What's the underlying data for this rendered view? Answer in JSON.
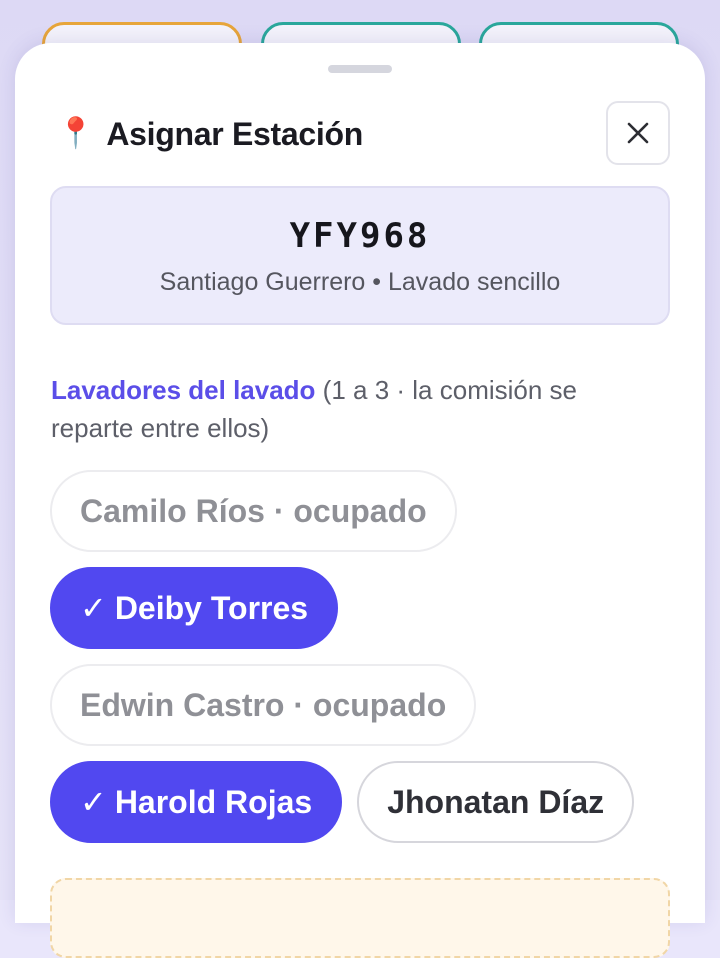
{
  "sheet": {
    "title": "Asignar Estación",
    "title_icon": "📍",
    "close_icon": "close-icon"
  },
  "vehicle": {
    "plate": "YFY968",
    "subtitle": "Santiago Guerrero • Lavado sencillo"
  },
  "washers_section": {
    "label": "Lavadores del lavado",
    "hint": " (1 a 3 · la comisión se reparte entre ellos)"
  },
  "washers": [
    {
      "name": "Camilo Ríos · ocupado",
      "state": "busy"
    },
    {
      "name": "Deiby Torres",
      "state": "selected",
      "check": "✓"
    },
    {
      "name": "Edwin Castro · ocupado",
      "state": "busy"
    },
    {
      "name": "Harold Rojas",
      "state": "selected",
      "check": "✓"
    },
    {
      "name": "Jhonatan Díaz",
      "state": "available"
    }
  ],
  "colors": {
    "accent": "#5148f0",
    "busy_text": "#8f9096",
    "card_bg": "#ecebfb",
    "bg_card_orange": "#e7a53a",
    "bg_card_teal": "#2aa79b"
  }
}
